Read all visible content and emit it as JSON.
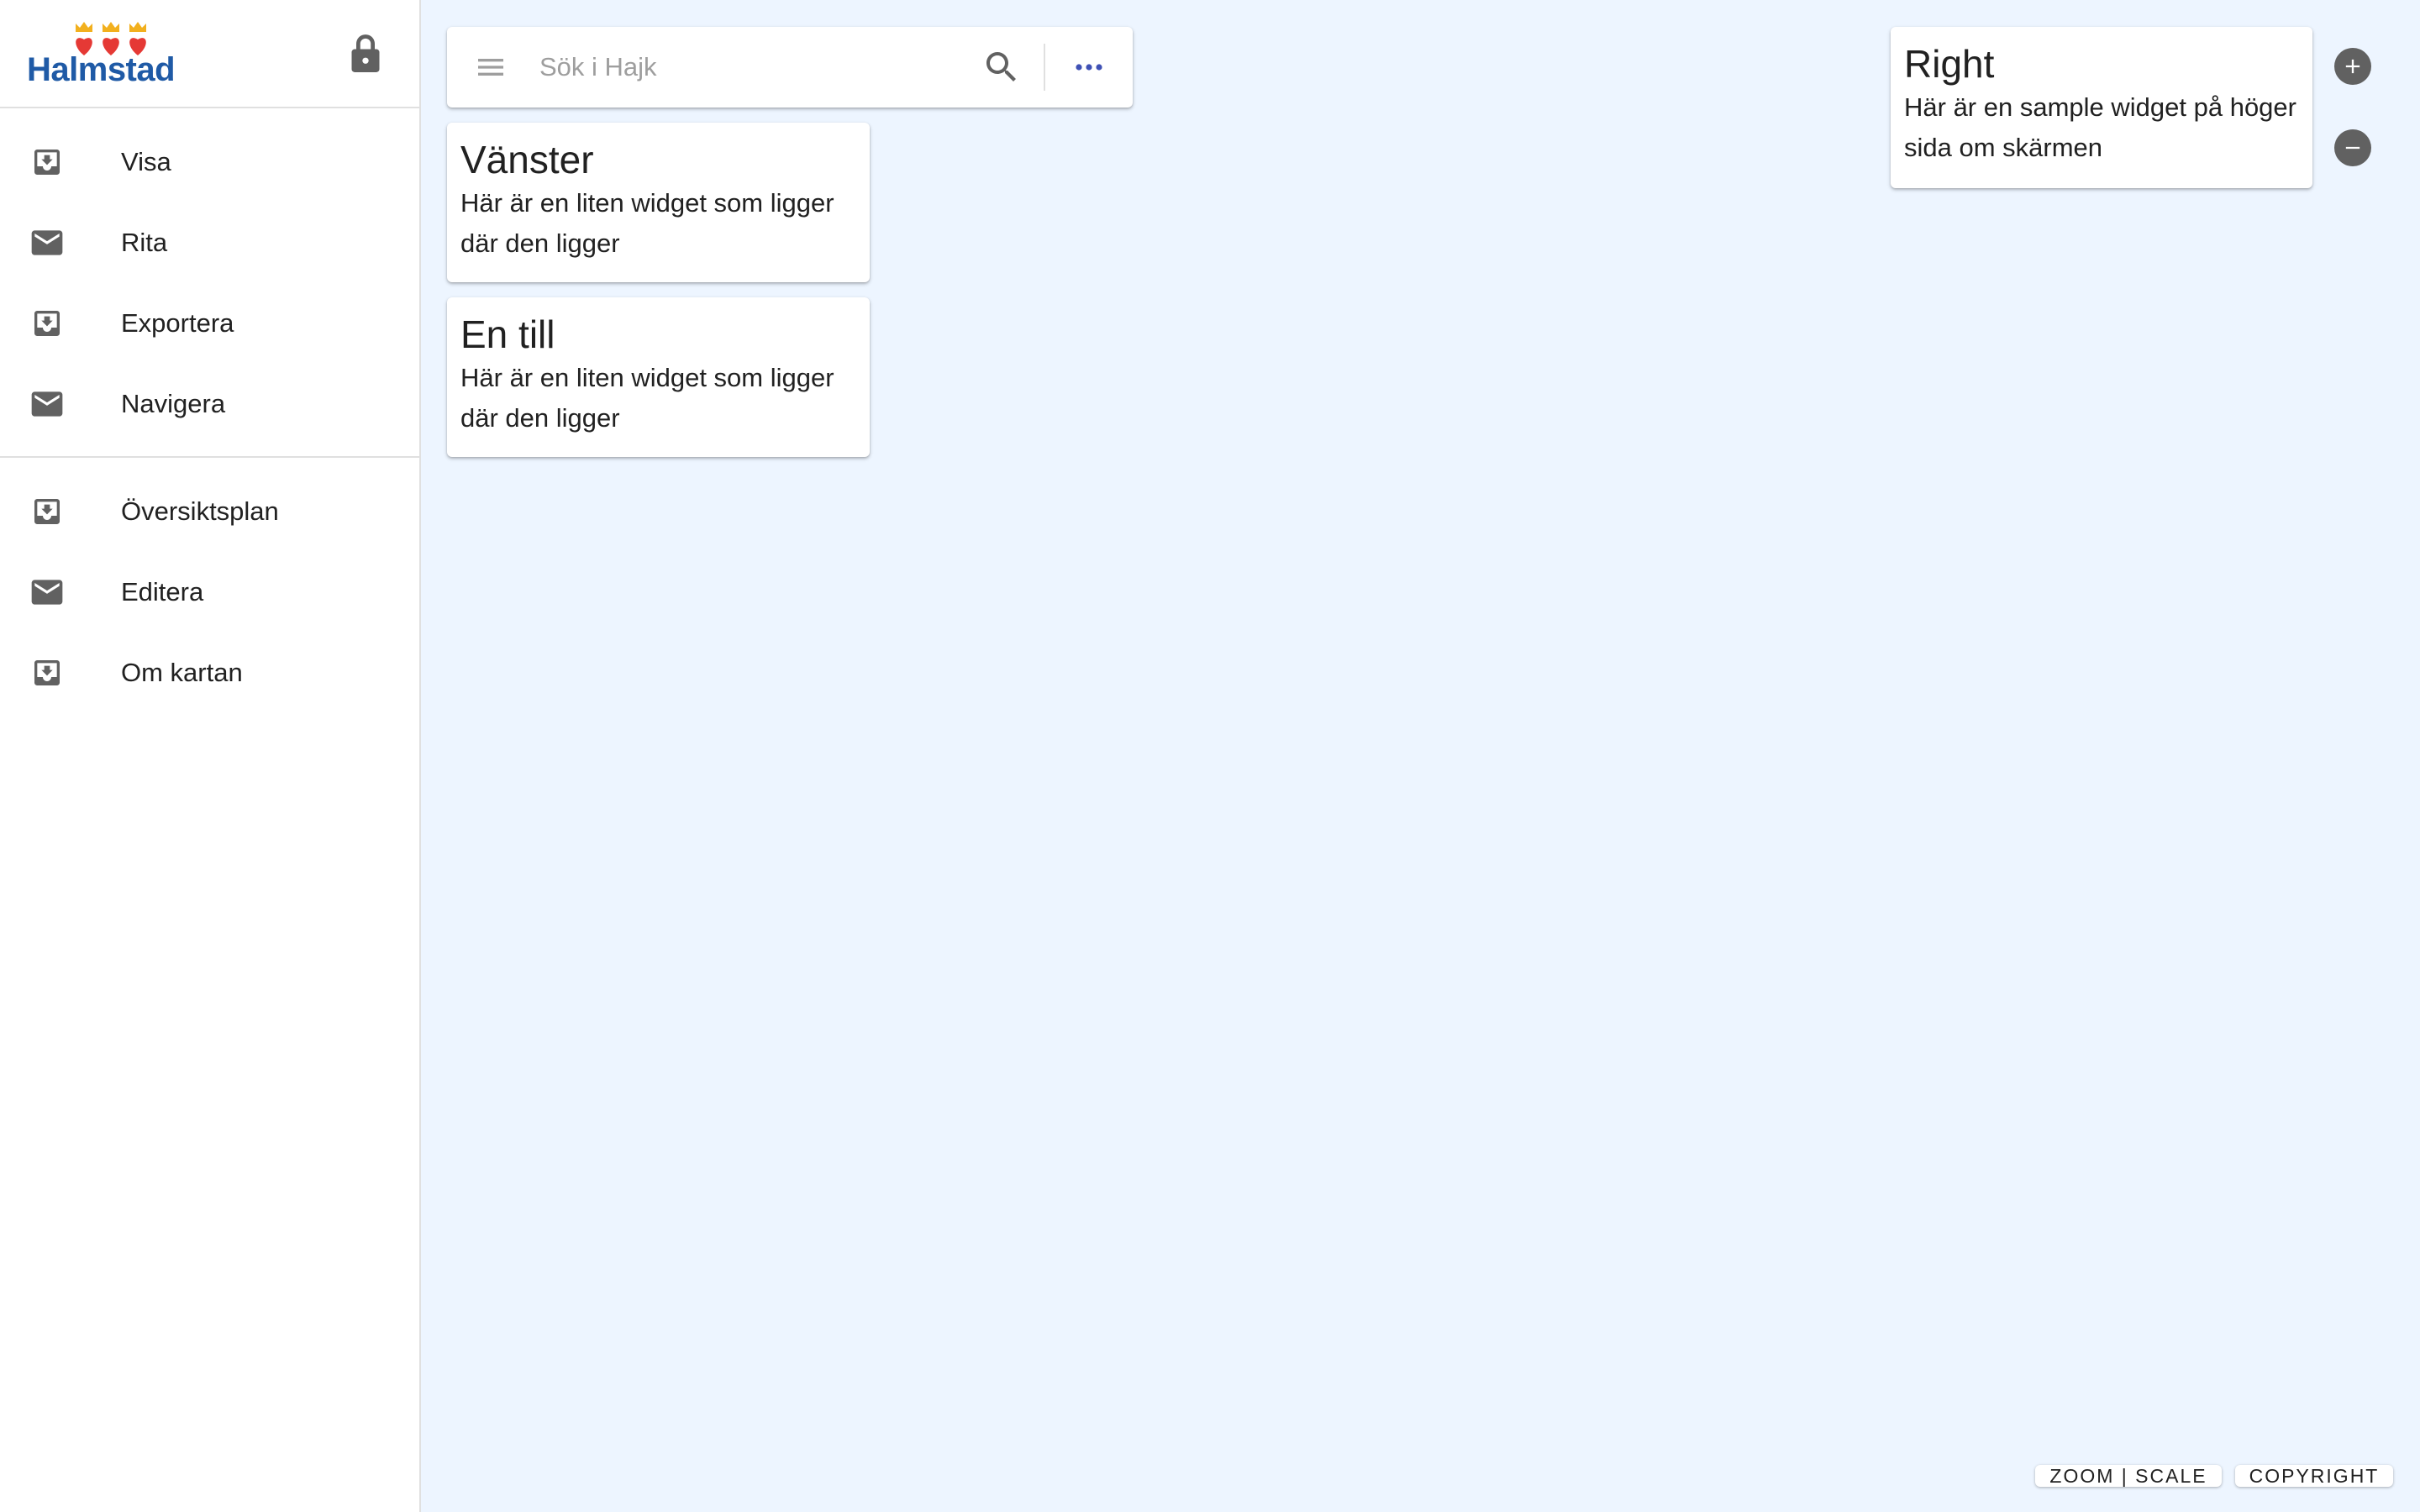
{
  "brand": {
    "logo_text": "Halmstad"
  },
  "sidebar": {
    "group1": [
      {
        "label": "Visa",
        "icon": "move-to-inbox-icon"
      },
      {
        "label": "Rita",
        "icon": "mail-icon"
      },
      {
        "label": "Exportera",
        "icon": "move-to-inbox-icon"
      },
      {
        "label": "Navigera",
        "icon": "mail-icon"
      }
    ],
    "group2": [
      {
        "label": "Översiktsplan",
        "icon": "move-to-inbox-icon"
      },
      {
        "label": "Editera",
        "icon": "mail-icon"
      },
      {
        "label": "Om kartan",
        "icon": "move-to-inbox-icon"
      }
    ]
  },
  "search": {
    "placeholder": "Sök i Hajk",
    "value": ""
  },
  "widgets": {
    "left1": {
      "title": "Vänster",
      "body": "Här är en liten widget som ligger där den ligger"
    },
    "left2": {
      "title": "En till",
      "body": "Här är en liten widget som ligger där den ligger"
    },
    "right": {
      "title": "Right",
      "body": "Här är en sample widget på höger sida om skärmen"
    }
  },
  "footer": {
    "zoom_scale": "ZOOM | SCALE",
    "copyright": "COPYRIGHT"
  },
  "colors": {
    "background": "#edf5ff",
    "icon_gray": "#616161",
    "accent_blue": "#3f51b5",
    "brand_blue": "#1f5aa6",
    "heart_red": "#e53935",
    "crown_gold": "#f2b01e"
  }
}
